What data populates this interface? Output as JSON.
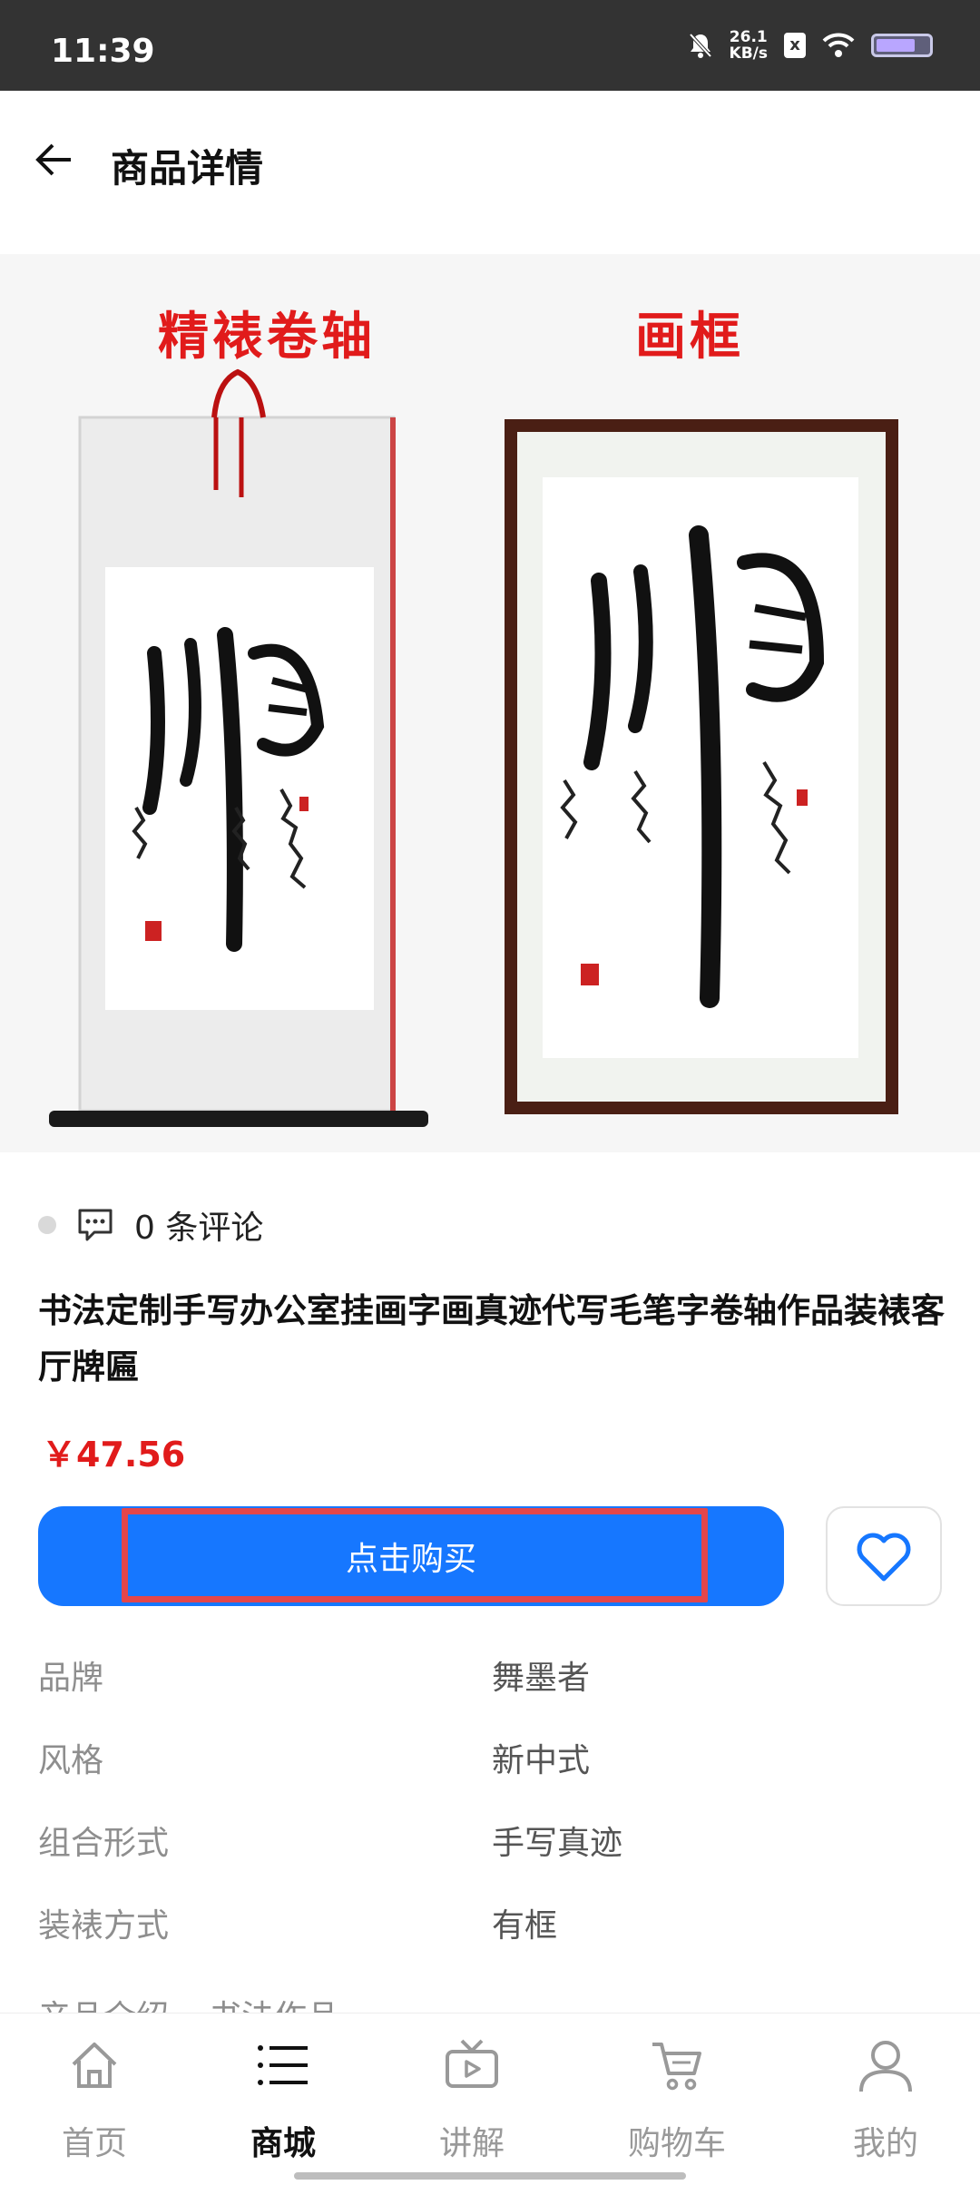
{
  "status_bar": {
    "time": "11:39",
    "net_speed_value": "26.1",
    "net_speed_unit": "KB/s",
    "sim_badge": "x"
  },
  "header": {
    "title": "商品详情",
    "back_icon": "arrow-left-icon"
  },
  "hero": {
    "label_left": "精裱卷轴",
    "label_right": "画框"
  },
  "reviews": {
    "text": "0 条评论"
  },
  "product": {
    "title": "书法定制手写办公室挂画字画真迹代写毛笔字卷轴作品装裱客厅牌匾",
    "price": "￥47.56"
  },
  "actions": {
    "buy_label": "点击购买",
    "favorite_icon": "heart-icon"
  },
  "specs": [
    {
      "label": "品牌",
      "value": "舞墨者"
    },
    {
      "label": "风格",
      "value": "新中式"
    },
    {
      "label": "组合形式",
      "value": "手写真迹"
    },
    {
      "label": "装裱方式",
      "value": "有框"
    }
  ],
  "specs_partial": {
    "label": "产品介绍",
    "value": "书法作品"
  },
  "tabbar": [
    {
      "label": "首页",
      "icon": "home-icon",
      "active": false
    },
    {
      "label": "商城",
      "icon": "list-icon",
      "active": true
    },
    {
      "label": "讲解",
      "icon": "tv-icon",
      "active": false
    },
    {
      "label": "购物车",
      "icon": "cart-icon",
      "active": false
    },
    {
      "label": "我的",
      "icon": "user-icon",
      "active": false
    }
  ],
  "colors": {
    "accent": "#1677ff",
    "price": "#e11b1b",
    "highlight": "#e4464a"
  }
}
